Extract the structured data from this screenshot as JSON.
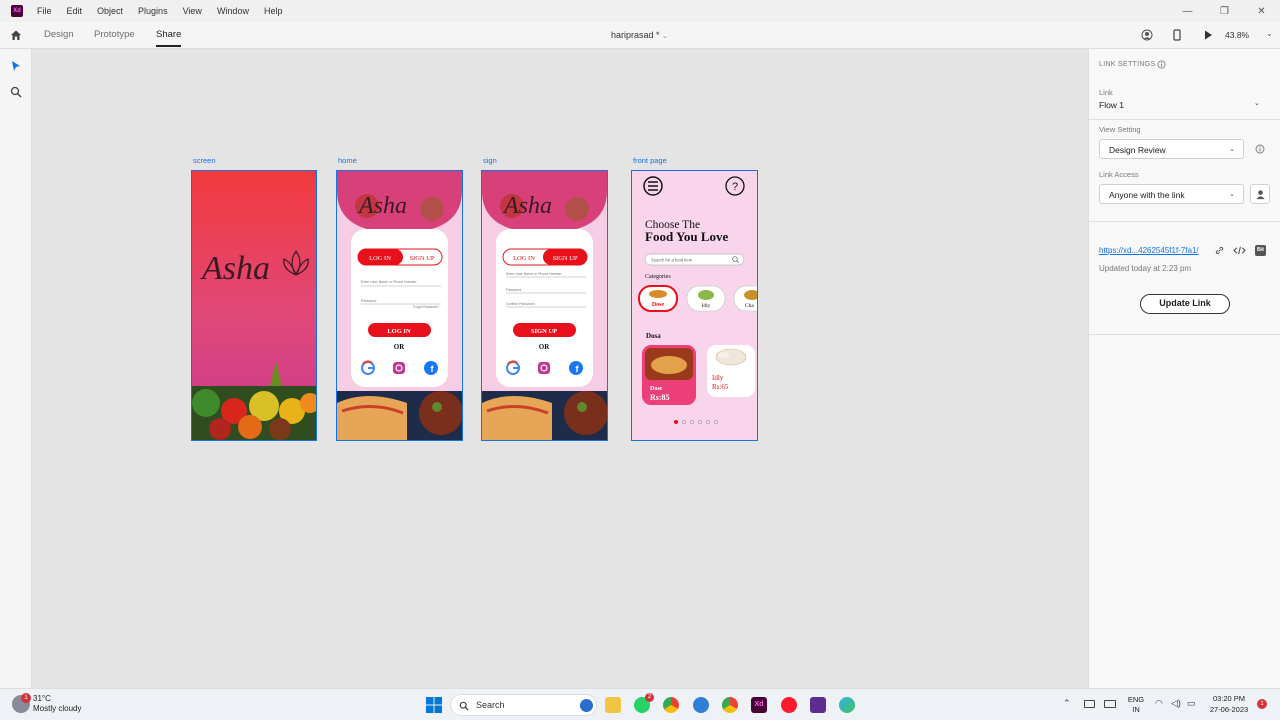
{
  "menubar": {
    "app_logo": "Xd",
    "items": [
      "File",
      "Edit",
      "Object",
      "Plugins",
      "View",
      "Window",
      "Help"
    ]
  },
  "toolbar": {
    "tabs": [
      "Design",
      "Prototype",
      "Share"
    ],
    "active_tab": "Share",
    "doc_title": "hariprasad *",
    "zoom": "43.8%"
  },
  "artboards": [
    {
      "label": "screen"
    },
    {
      "label": "home"
    },
    {
      "label": "sign"
    },
    {
      "label": "front page"
    }
  ],
  "screen_artboard": {
    "logo_text": "Asha"
  },
  "home_artboard": {
    "logo_text": "Asha",
    "login_tab": "LOG IN",
    "signup_tab": "SIGN UP",
    "field_user": "Enter User Name or Phone Number",
    "field_password": "Password",
    "forgot": "Forgot Password?",
    "login_button": "LOG IN",
    "or_text": "OR"
  },
  "sign_artboard": {
    "logo_text": "Asha",
    "login_tab": "LOG IN",
    "signup_tab": "SIGN UP",
    "field_user": "Enter User Name or Phone Number",
    "field_password": "Password",
    "field_confirm": "Confirm Password",
    "signup_button": "SIGN UP",
    "or_text": "OR"
  },
  "front_artboard": {
    "heading_line1": "Choose The",
    "heading_line2": "Food You Love",
    "search_placeholder": "Search for a food item",
    "categories_title": "Categories",
    "categories": [
      "Dose",
      "Idly",
      "Cha"
    ],
    "section_title": "Dosa",
    "cards": [
      {
        "name": "Dose",
        "price": "Rs:85"
      },
      {
        "name": "Idly",
        "price": "Rs:65"
      }
    ]
  },
  "right_panel": {
    "section_title": "LINK SETTINGS",
    "link_label": "Link",
    "link_value": "Flow 1",
    "view_setting_label": "View Setting",
    "view_setting_value": "Design Review",
    "link_access_label": "Link Access",
    "link_access_value": "Anyone with the link",
    "link_url": "https://xd...4262545f1f-7fa1/",
    "updated_text": "Updated today at 2:23 pm",
    "update_button": "Update Link"
  },
  "taskbar": {
    "weather_temp": "31°C",
    "weather_desc": "Mostly cloudy",
    "weather_badge": "1",
    "search_placeholder": "Search",
    "whatsapp_badge": "2",
    "lang": "ENG",
    "region": "IN",
    "time": "03:20 PM",
    "date": "27-06-2023",
    "notification_badge": "1"
  },
  "colors": {
    "accent": "#1473e6",
    "brand_red": "#e8101a",
    "xd_purple": "#470137"
  }
}
